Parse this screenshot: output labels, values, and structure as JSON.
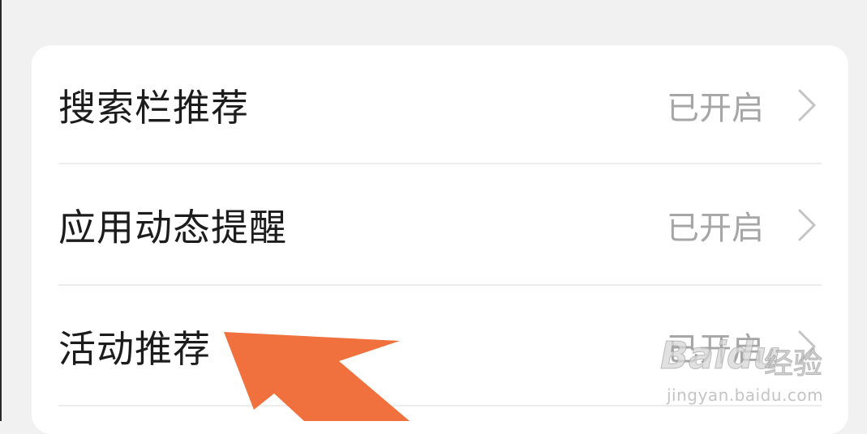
{
  "settings": {
    "items": [
      {
        "label": "搜索栏推荐",
        "value": "已开启",
        "chevron_icon": "chevron-right-icon"
      },
      {
        "label": "应用动态提醒",
        "value": "已开启",
        "chevron_icon": "chevron-right-icon"
      },
      {
        "label": "活动推荐",
        "value": "已开启",
        "chevron_icon": "chevron-right-icon"
      }
    ]
  },
  "annotation": {
    "arrow_color": "#f0703e",
    "arrow_icon": "arrow-pointer-icon"
  },
  "watermark": {
    "brand": "Baidu",
    "suffix": "经验",
    "url": "jingyan.baidu.com"
  },
  "colors": {
    "background": "#f1f1f1",
    "card": "#ffffff",
    "label": "#1c1c1c",
    "value": "#a6a6a6",
    "divider": "#ececec"
  }
}
